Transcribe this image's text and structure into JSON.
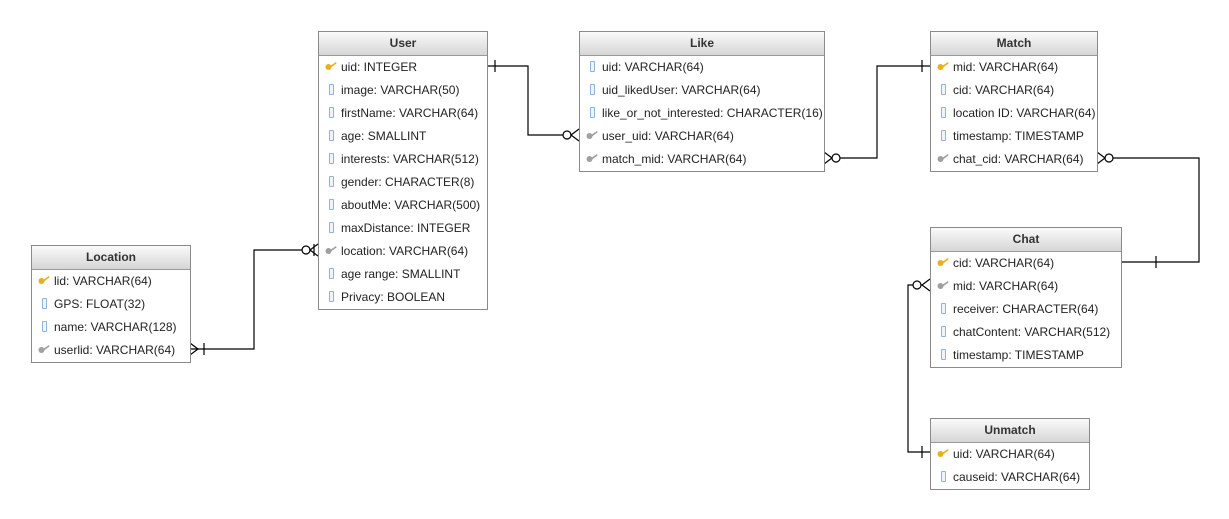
{
  "tables": {
    "user": {
      "name": "User",
      "fields": [
        {
          "text": "uid: INTEGER",
          "icon": "pk"
        },
        {
          "text": "image: VARCHAR(50)",
          "icon": "col"
        },
        {
          "text": "firstName: VARCHAR(64)",
          "icon": "col"
        },
        {
          "text": "age: SMALLINT",
          "icon": "col"
        },
        {
          "text": "interests: VARCHAR(512)",
          "icon": "col"
        },
        {
          "text": "gender: CHARACTER(8)",
          "icon": "col"
        },
        {
          "text": "aboutMe: VARCHAR(500)",
          "icon": "col"
        },
        {
          "text": "maxDistance: INTEGER",
          "icon": "col"
        },
        {
          "text": "location: VARCHAR(64)",
          "icon": "fk"
        },
        {
          "text": "age range: SMALLINT",
          "icon": "col"
        },
        {
          "text": "Privacy: BOOLEAN",
          "icon": "col"
        }
      ]
    },
    "like": {
      "name": "Like",
      "fields": [
        {
          "text": "uid: VARCHAR(64)",
          "icon": "col"
        },
        {
          "text": "uid_likedUser: VARCHAR(64)",
          "icon": "col"
        },
        {
          "text": "like_or_not_interested: CHARACTER(16)",
          "icon": "col"
        },
        {
          "text": "user_uid: VARCHAR(64)",
          "icon": "fk"
        },
        {
          "text": "match_mid: VARCHAR(64)",
          "icon": "fk"
        }
      ]
    },
    "match": {
      "name": "Match",
      "fields": [
        {
          "text": "mid: VARCHAR(64)",
          "icon": "pk"
        },
        {
          "text": "cid: VARCHAR(64)",
          "icon": "col"
        },
        {
          "text": "location ID: VARCHAR(64)",
          "icon": "col"
        },
        {
          "text": "timestamp: TIMESTAMP",
          "icon": "col"
        },
        {
          "text": "chat_cid: VARCHAR(64)",
          "icon": "fk"
        }
      ]
    },
    "location": {
      "name": "Location",
      "fields": [
        {
          "text": "lid: VARCHAR(64)",
          "icon": "pk"
        },
        {
          "text": "GPS: FLOAT(32)",
          "icon": "col"
        },
        {
          "text": "name: VARCHAR(128)",
          "icon": "col"
        },
        {
          "text": "userlid: VARCHAR(64)",
          "icon": "fk"
        }
      ]
    },
    "chat": {
      "name": "Chat",
      "fields": [
        {
          "text": "cid: VARCHAR(64)",
          "icon": "pk"
        },
        {
          "text": "mid: VARCHAR(64)",
          "icon": "fk"
        },
        {
          "text": "receiver: CHARACTER(64)",
          "icon": "col"
        },
        {
          "text": "chatContent: VARCHAR(512)",
          "icon": "col"
        },
        {
          "text": "timestamp: TIMESTAMP",
          "icon": "col"
        }
      ]
    },
    "unmatch": {
      "name": "Unmatch",
      "fields": [
        {
          "text": "uid: VARCHAR(64)",
          "icon": "pk"
        },
        {
          "text": "causeid: VARCHAR(64)",
          "icon": "col"
        }
      ]
    }
  },
  "colors": {
    "primary_key": "#e8b020",
    "foreign_key": "#a0a0a0",
    "column": "#8fb3d9",
    "line": "#000000"
  }
}
